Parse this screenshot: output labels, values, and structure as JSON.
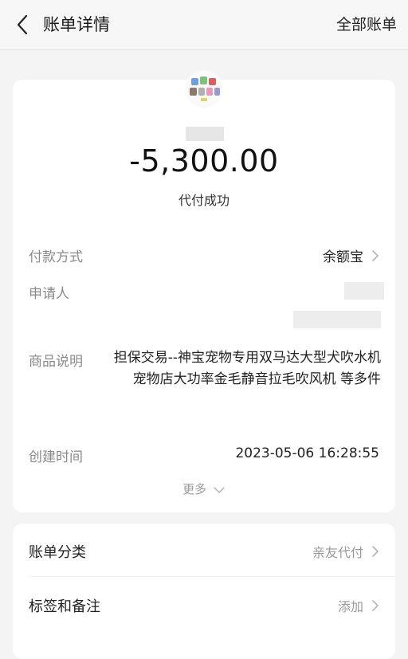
{
  "header": {
    "title": "账单详情",
    "all_bills": "全部账单"
  },
  "summary": {
    "amount": "-5,300.00",
    "status": "代付成功"
  },
  "details": {
    "payment_method_label": "付款方式",
    "payment_method_value": "余额宝",
    "applicant_label": "申请人",
    "product_desc_label": "商品说明",
    "product_desc_value": "担保交易--神宝宠物专用双马达大型犬吹水机宠物店大功率金毛静音拉毛吹风机 等多件",
    "created_time_label": "创建时间",
    "created_time_value": "2023-05-06 16:28:55",
    "more_label": "更多"
  },
  "extra": {
    "category_label": "账单分类",
    "category_value": "亲友代付",
    "tags_label": "标签和备注",
    "tags_value": "添加"
  },
  "colors": {
    "background": "#f4f4f4",
    "card": "#ffffff",
    "muted": "#999999"
  }
}
